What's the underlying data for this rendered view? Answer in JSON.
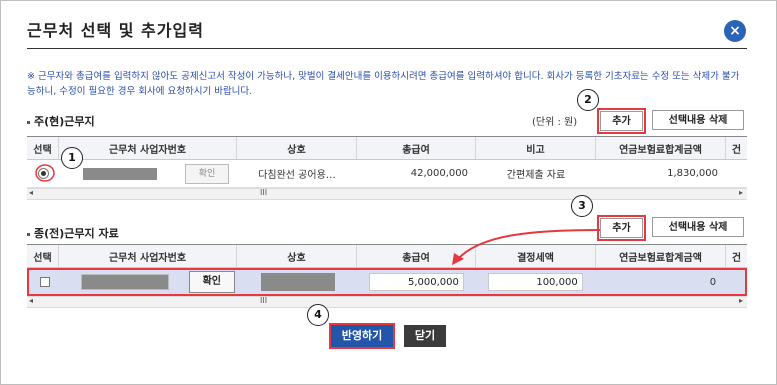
{
  "dialog": {
    "title": "근무처 선택 및 추가입력",
    "close_icon": "×"
  },
  "notice": "※ 근무자와 총급여를 입력하지 않아도 공제신고서 작성이 가능하나, 맞벌이 결세안내를 이용하시려면 총급여를 입력하셔야 합니다. 회사가 등록한 기초자료는 수정 또는 삭제가 불가능하니, 수정이 필요한 경우 회사에 요청하시기 바랍니다.",
  "current": {
    "section_title": "주(현)근무지",
    "unit": "(단위 : 원)",
    "add_label": "추가",
    "delete_label": "선택내용 삭제",
    "columns": [
      "선택",
      "근무처 사업자번호",
      "상호",
      "총급여",
      "비고",
      "연금보험료합계금액",
      "건"
    ],
    "row": {
      "confirm_label": "확인",
      "company": "다침완선 공어용…",
      "salary": "42,000,000",
      "note": "간편제출 자료",
      "pension_total": "1,830,000"
    },
    "scroll_thumb": "III"
  },
  "previous": {
    "section_title": "종(전)근무지 자료",
    "add_label": "추가",
    "delete_label": "선택내용 삭제",
    "columns": [
      "선택",
      "근무처 사업자번호",
      "상호",
      "총급여",
      "결정세액",
      "연금보험료합계금액",
      "건"
    ],
    "row": {
      "confirm_label": "확인",
      "salary": "5,000,000",
      "decided_tax": "100,000",
      "pension_total": "0"
    },
    "scroll_thumb": "III"
  },
  "footer": {
    "apply_label": "반영하기",
    "close_label": "닫기"
  },
  "steps": [
    "1",
    "2",
    "3",
    "4"
  ],
  "colors": {
    "highlight": "#e5383f",
    "primary": "#2356a9",
    "notice_text": "#2b4fae"
  }
}
